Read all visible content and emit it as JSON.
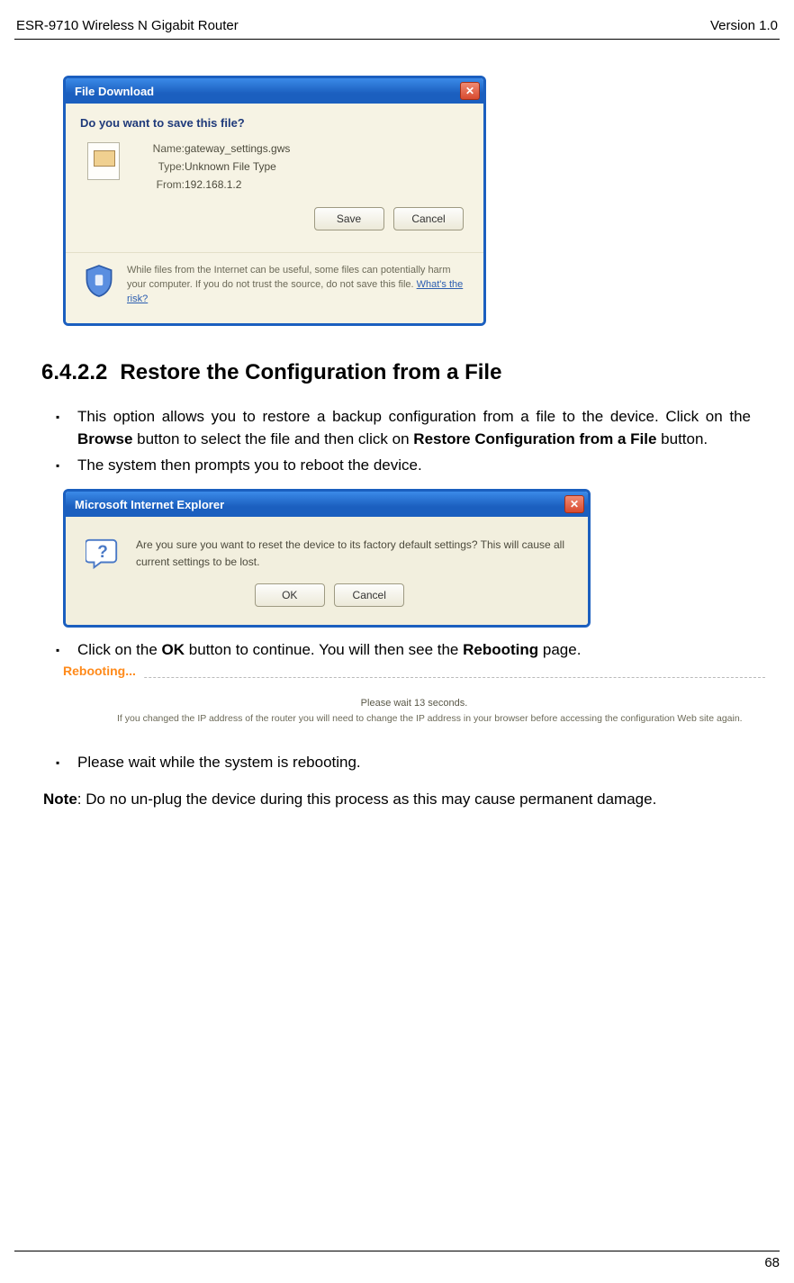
{
  "header": {
    "left": "ESR-9710 Wireless N Gigabit Router",
    "right": "Version 1.0"
  },
  "file_download": {
    "title": "File Download",
    "question": "Do you want to save this file?",
    "labels": {
      "name": "Name:",
      "type": "Type:",
      "from": "From:"
    },
    "values": {
      "name": "gateway_settings.gws",
      "type": "Unknown File Type",
      "from": "192.168.1.2"
    },
    "save_label": "Save",
    "cancel_label": "Cancel",
    "warning": "While files from the Internet can be useful, some files can potentially harm your computer. If you do not trust the source, do not save this file. ",
    "risk_link": "What's the risk?"
  },
  "section": {
    "number": "6.4.2.2",
    "title": "Restore the Configuration from a File",
    "para1_a": "This option allows you to restore a backup configuration from a file to the device. Click on the ",
    "para1_browse": "Browse",
    "para1_b": " button to select the file and then click on ",
    "para1_restore": "Restore Configuration from a File",
    "para1_c": " button.",
    "para2": "The system then prompts you to reboot the device."
  },
  "ie_dialog": {
    "title": "Microsoft Internet Explorer",
    "message": "Are you sure you want to reset the device to its factory default settings? This will cause all current settings to be lost.",
    "ok_label": "OK",
    "cancel_label": "Cancel"
  },
  "after_ie": {
    "click_a": "Click on the ",
    "ok": "OK",
    "click_b": " button to continue.  You will then see the ",
    "rebooting": "Rebooting",
    "click_c": " page."
  },
  "rebooting": {
    "title": "Rebooting...",
    "wait": "Please wait 13 seconds.",
    "note": "If you changed the IP address of the router you will need to change the IP address in your browser before accessing the configuration Web site again."
  },
  "final": {
    "bullet": "Please wait while the system is rebooting.",
    "note_label": "Note",
    "note_text": ": Do no un-plug the device during this process as this may cause permanent damage."
  },
  "page_number": "68"
}
